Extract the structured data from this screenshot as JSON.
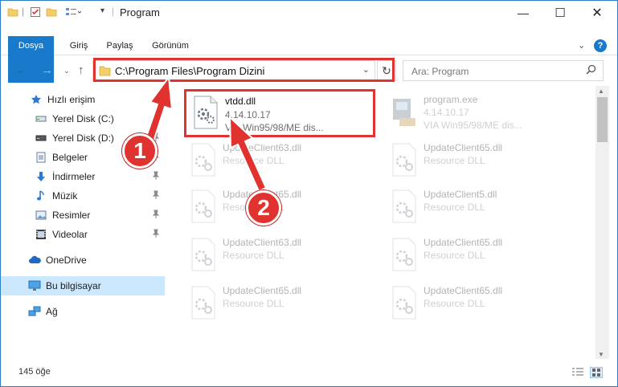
{
  "window": {
    "title": "Program",
    "controls": {
      "minimize": "—",
      "maximize": "☐",
      "close": "✕"
    }
  },
  "ribbon": {
    "tabs": [
      "Dosya",
      "Giriş",
      "Paylaş",
      "Görünüm"
    ],
    "help_glyph": "?"
  },
  "address_bar": {
    "path": "C:\\Program Files\\Program Dizini",
    "search_placeholder": "Ara: Program"
  },
  "nav_pane": {
    "items": [
      {
        "label": "Hızlı erişim",
        "icon": "star-icon",
        "pinned": false
      },
      {
        "label": "Yerel Disk (C:)",
        "icon": "drive-icon",
        "pinned": true
      },
      {
        "label": "Yerel Disk (D:)",
        "icon": "drive-icon",
        "pinned": true
      },
      {
        "label": "Belgeler",
        "icon": "documents-icon",
        "pinned": true
      },
      {
        "label": "İndirmeler",
        "icon": "download-icon",
        "pinned": true
      },
      {
        "label": "Müzik",
        "icon": "music-icon",
        "pinned": true
      },
      {
        "label": "Resimler",
        "icon": "pictures-icon",
        "pinned": true
      },
      {
        "label": "Videolar",
        "icon": "video-icon",
        "pinned": true
      },
      {
        "label": "OneDrive",
        "icon": "cloud-icon",
        "pinned": false
      },
      {
        "label": "Bu bilgisayar",
        "icon": "computer-icon",
        "pinned": false,
        "selected": true
      },
      {
        "label": "Ağ",
        "icon": "network-icon",
        "pinned": false
      }
    ]
  },
  "files": [
    {
      "name": "vtdd.dll",
      "line2": "4.14.10.17",
      "line3": "VIA Win95/98/ME dis...",
      "highlighted": true
    },
    {
      "name": "program.exe",
      "line2": "4.14.10.17",
      "line3": "VIA Win95/98/ME dis...",
      "faded": true
    },
    {
      "name": "UpdateClient63.dll",
      "line2": "Resource DLL",
      "faded": true
    },
    {
      "name": "UpdateClient65.dll",
      "line2": "Resource DLL",
      "faded": true
    },
    {
      "name": "UpdateClient65.dll",
      "line2": "Resource DLL",
      "faded": true
    },
    {
      "name": "UpdateClient5.dll",
      "line2": "Resource DLL",
      "faded": true
    },
    {
      "name": "UpdateClient63.dll",
      "line2": "Resource DLL",
      "faded": true
    },
    {
      "name": "UpdateClient65.dll",
      "line2": "Resource DLL",
      "faded": true
    },
    {
      "name": "UpdateClient65.dll",
      "line2": "Resource DLL",
      "faded": true
    },
    {
      "name": "UpdateClient65.dll",
      "line2": "Resource DLL",
      "faded": true
    }
  ],
  "status_bar": {
    "item_count": "145 öğe"
  },
  "annotations": {
    "step1": "1",
    "step2": "2"
  },
  "colors": {
    "accent": "#1979ca",
    "highlight_red": "#e0322f",
    "selected_nav": "#cce8ff"
  }
}
